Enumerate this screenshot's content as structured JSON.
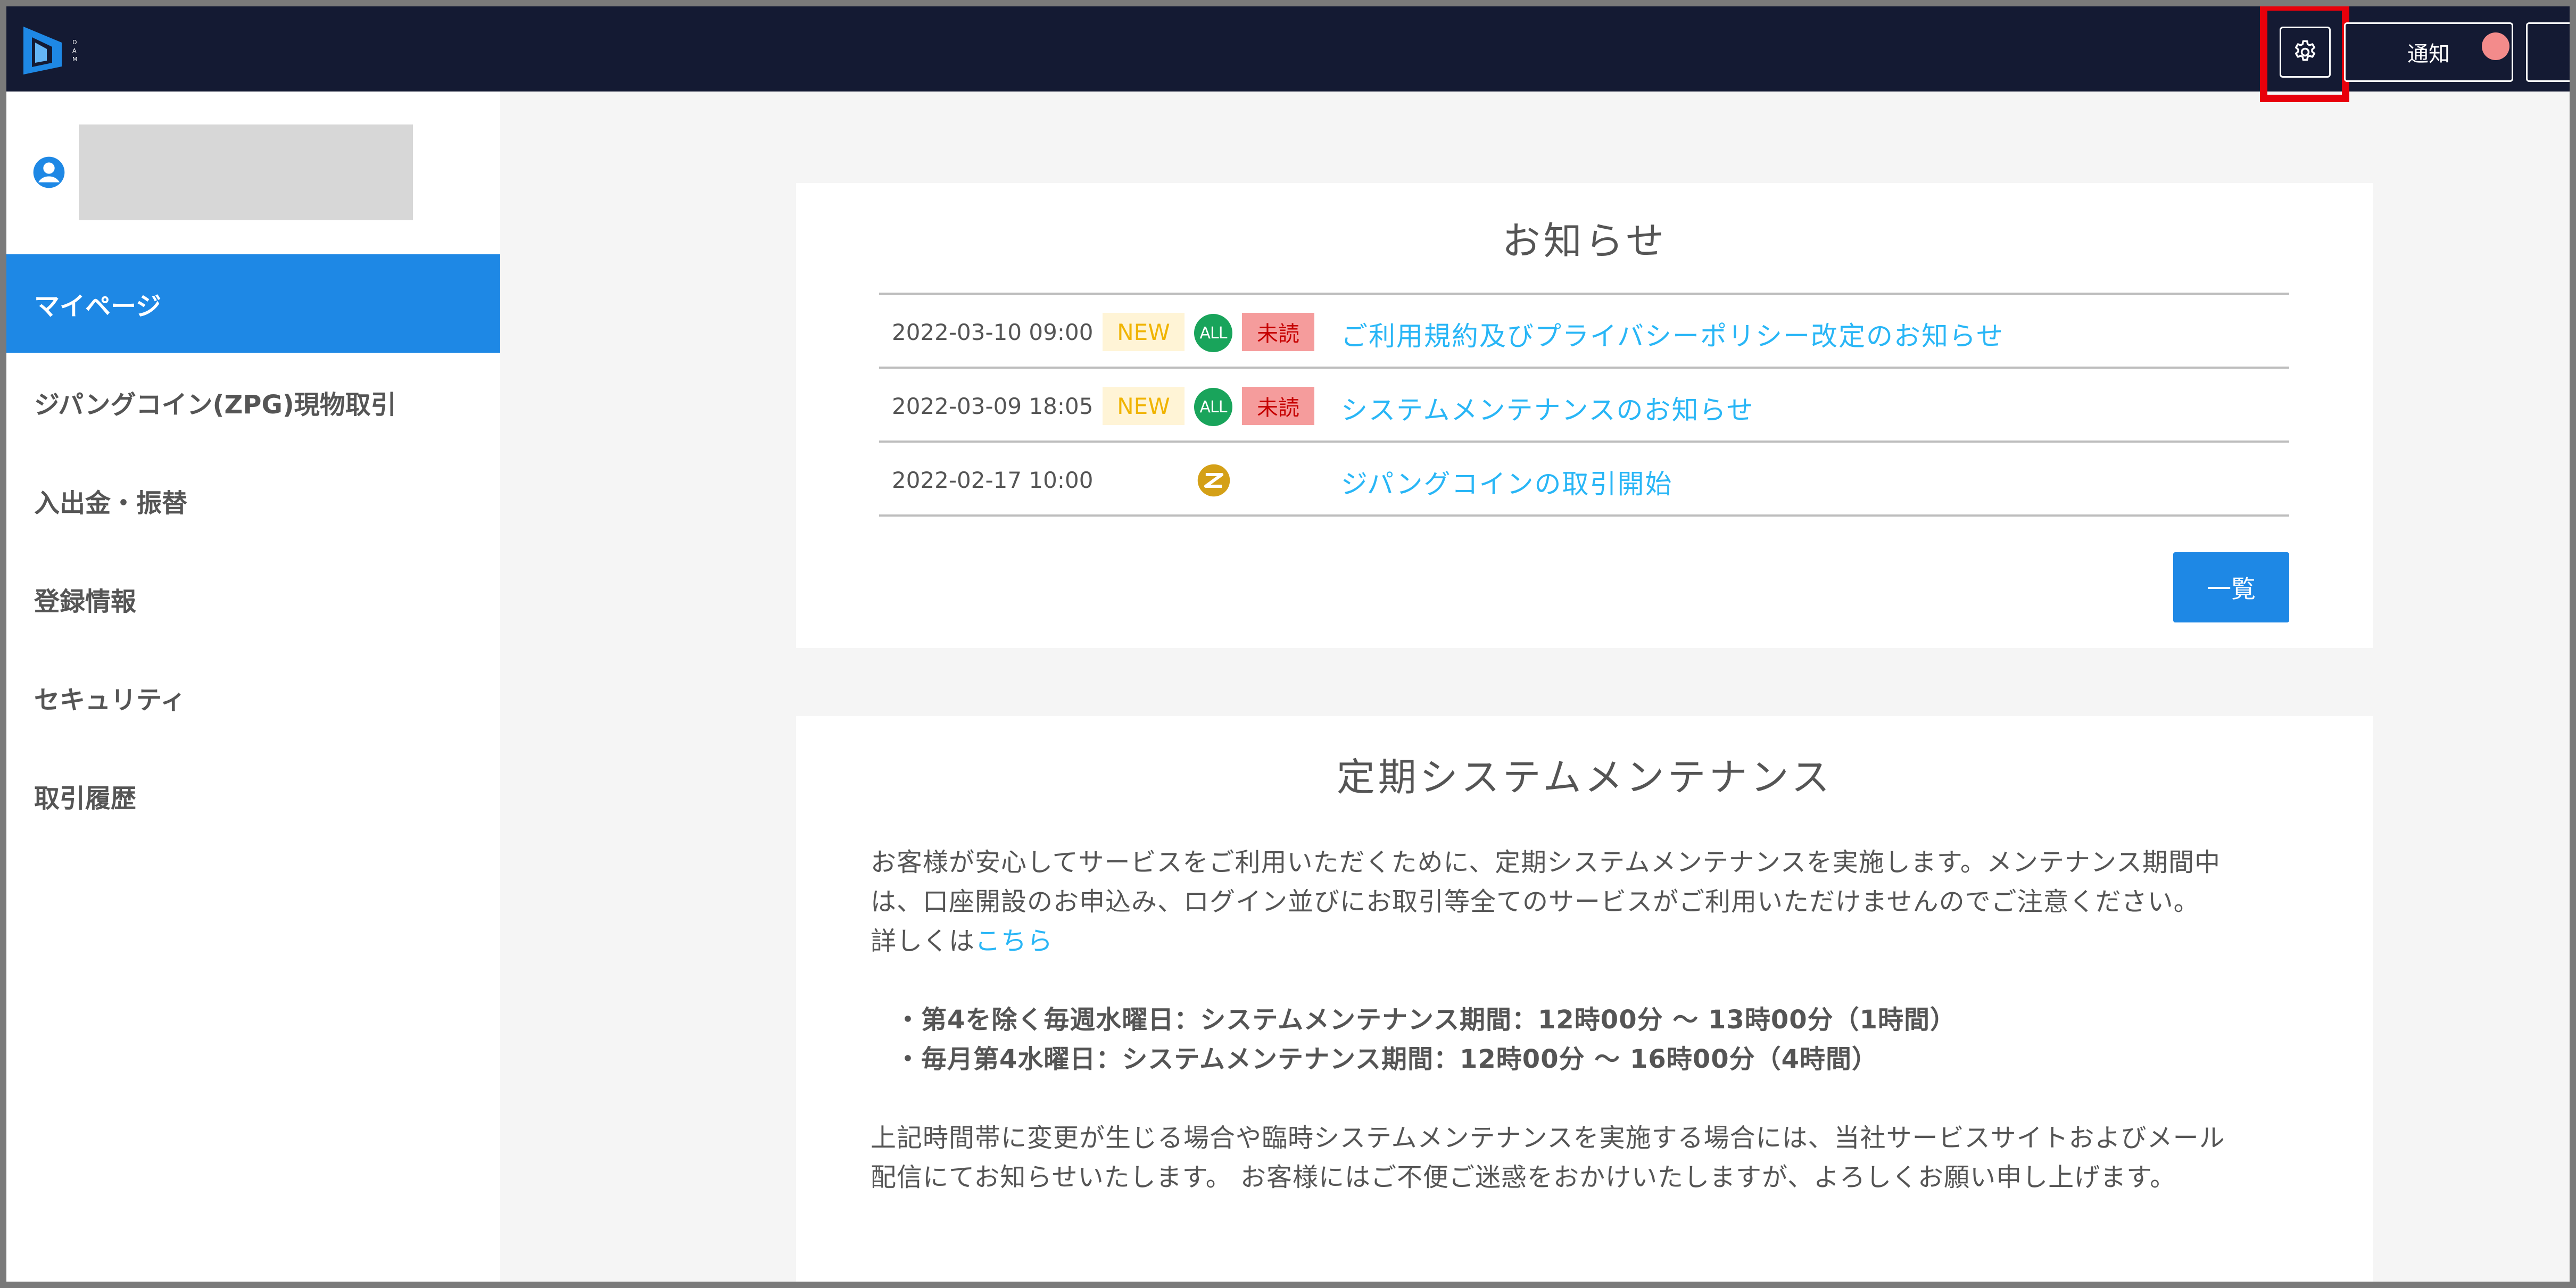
{
  "header": {
    "logo_text": [
      "D",
      "A",
      "M"
    ],
    "notify_label": "通知"
  },
  "sidebar": {
    "items": [
      {
        "label": "マイページ",
        "active": true
      },
      {
        "label": "ジパングコイン(ZPG)現物取引"
      },
      {
        "label": "入出金・振替"
      },
      {
        "label": "登録情報"
      },
      {
        "label": "セキュリティ"
      },
      {
        "label": "取引履歴"
      }
    ]
  },
  "news": {
    "title": "お知らせ",
    "rows": [
      {
        "date": "2022-03-10 09:00",
        "new": "NEW",
        "all": "ALL",
        "unread": "未読",
        "text": "ご利用規約及びプライバシーポリシー改定のお知らせ"
      },
      {
        "date": "2022-03-09 18:05",
        "new": "NEW",
        "all": "ALL",
        "unread": "未読",
        "text": "システムメンテナンスのお知らせ"
      },
      {
        "date": "2022-02-17 10:00",
        "text": "ジパングコインの取引開始"
      }
    ],
    "list_button": "一覧"
  },
  "maintenance": {
    "title": "定期システムメンテナンス",
    "intro_line1": "お客様が安心してサービスをご利用いただくために、定期システムメンテナンスを実施します。メンテナンス期間中",
    "intro_line2": "は、口座開設のお申込み、ログイン並びにお取引等全てのサービスがご利用いただけませんのでご注意ください。",
    "details_prefix": "詳しくは",
    "details_link": "こちら",
    "schedule": [
      "・第4を除く毎週水曜日：システムメンテナンス期間：12時00分 〜 13時00分（1時間）",
      "・毎月第4水曜日：システムメンテナンス期間：12時00分 〜 16時00分（4時間）"
    ],
    "footer_line1": "上記時間帯に変更が生じる場合や臨時システムメンテナンスを実施する場合には、当社サービスサイトおよびメール",
    "footer_line2": "配信にてお知らせいたします。 お客様にはご不便ご迷惑をおかけいたしますが、よろしくお願い申し上げます。"
  },
  "colors": {
    "header_bg": "#141a33",
    "accent": "#1e88e5",
    "link": "#29b6f6",
    "highlight": "#e8000b"
  }
}
